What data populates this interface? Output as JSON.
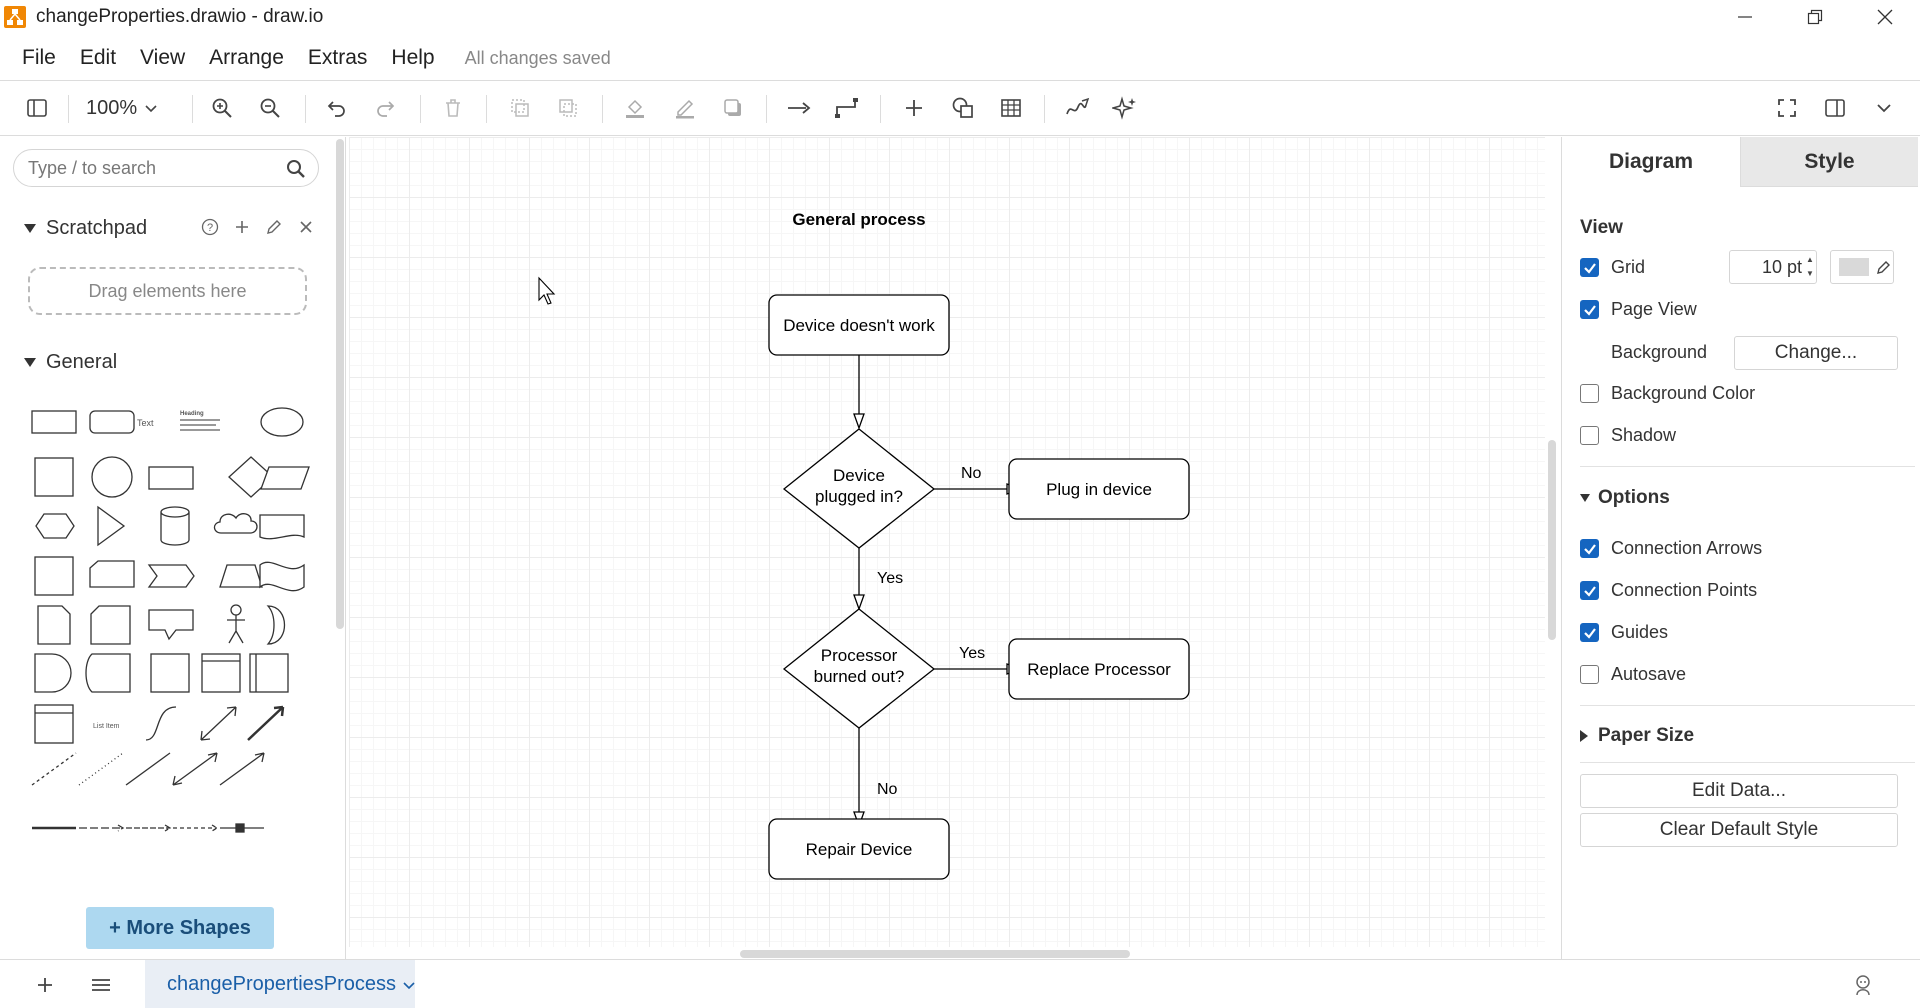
{
  "window": {
    "title": "changeProperties.drawio - draw.io",
    "minimize_icon": "minimize-icon",
    "maximize_icon": "restore-icon",
    "close_icon": "close-icon"
  },
  "menu": {
    "items": [
      "File",
      "Edit",
      "View",
      "Arrange",
      "Extras",
      "Help"
    ],
    "status": "All changes saved"
  },
  "toolbar": {
    "zoom_level": "100%",
    "icons": [
      "sidebar-toggle-icon",
      "zoom-in-icon",
      "zoom-out-icon",
      "undo-icon",
      "redo-icon",
      "delete-icon",
      "to-front-icon",
      "to-back-icon",
      "fill-color-icon",
      "line-color-icon",
      "shadow-icon",
      "connection-icon",
      "waypoints-icon",
      "insert-icon",
      "shapes-icon",
      "table-icon",
      "freehand-icon",
      "ai-generate-icon",
      "fullscreen-icon",
      "format-panel-icon",
      "collapse-icon"
    ]
  },
  "left_panel": {
    "search_placeholder": "Type / to search",
    "scratchpad_title": "Scratchpad",
    "scratchpad_dropzone": "Drag elements here",
    "general_title": "General",
    "shape_text_label": "Text",
    "shape_heading_label": "Heading",
    "shape_list_item_label": "List Item",
    "more_shapes": "+ More Shapes"
  },
  "diagram": {
    "title": "General process",
    "nodes": {
      "start": "Device doesn't work",
      "decision1": [
        "Device",
        "plugged in?"
      ],
      "plug": "Plug in device",
      "decision2": [
        "Processor",
        "burned out?"
      ],
      "replace": "Replace Processor",
      "repair": "Repair Device"
    },
    "edge_labels": {
      "d1_no": "No",
      "d1_yes": "Yes",
      "d2_yes": "Yes",
      "d2_no": "No"
    }
  },
  "right_panel": {
    "tabs": [
      "Diagram",
      "Style"
    ],
    "view_title": "View",
    "grid_label": "Grid",
    "grid_checked": true,
    "grid_size": "10 pt",
    "page_view_label": "Page View",
    "page_view_checked": true,
    "background_label": "Background",
    "change_button": "Change...",
    "background_color_label": "Background Color",
    "background_color_checked": false,
    "shadow_label": "Shadow",
    "shadow_checked": false,
    "options_title": "Options",
    "connection_arrows_label": "Connection Arrows",
    "connection_arrows_checked": true,
    "connection_points_label": "Connection Points",
    "connection_points_checked": true,
    "guides_label": "Guides",
    "guides_checked": true,
    "autosave_label": "Autosave",
    "autosave_checked": false,
    "paper_size_title": "Paper Size",
    "edit_data_button": "Edit Data...",
    "clear_style_button": "Clear Default Style",
    "accent_color": "#1565c0"
  },
  "bottom_bar": {
    "page_name": "changePropertiesProcess"
  }
}
